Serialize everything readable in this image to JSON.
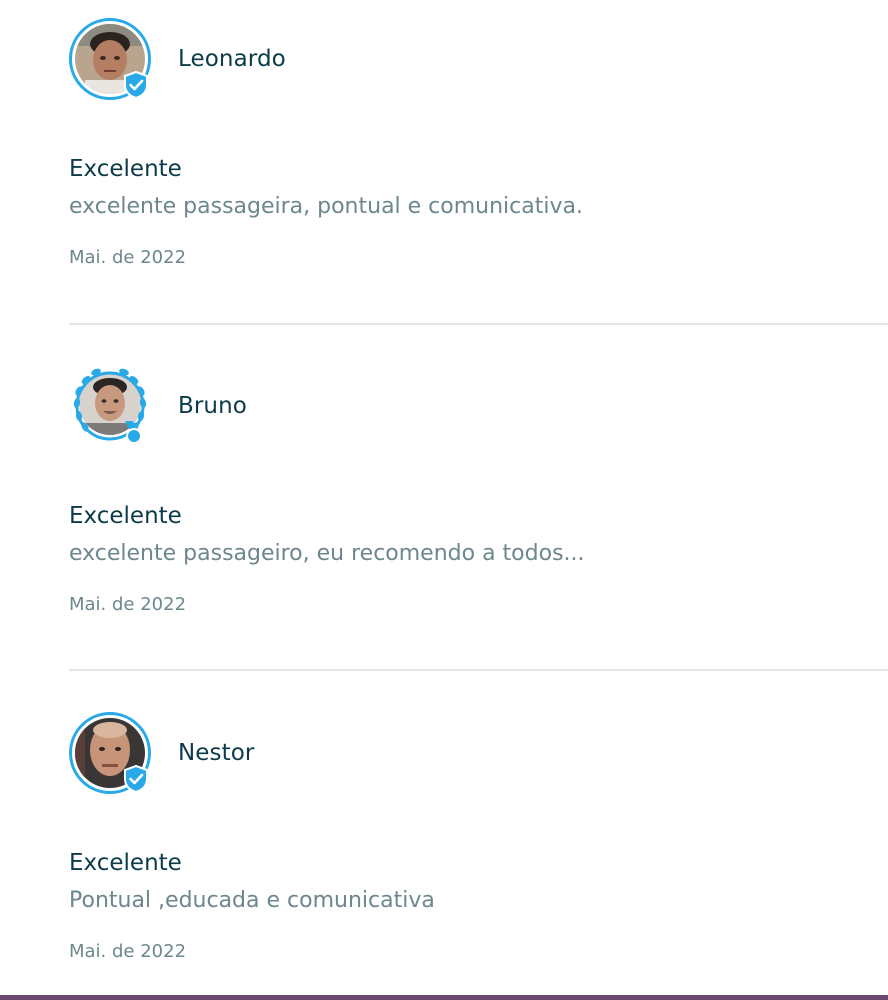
{
  "reviews": [
    {
      "name": "Leonardo",
      "rating": "Excelente",
      "comment": "excelente passageira, pontual e comunicativa.",
      "date": "Mai. de 2022",
      "badge": "verified-shield-icon"
    },
    {
      "name": "Bruno",
      "rating": "Excelente",
      "comment": "excelente passageiro, eu recomendo a todos...",
      "date": "Mai. de 2022",
      "badge": "medal-laurel-icon"
    },
    {
      "name": "Nestor",
      "rating": "Excelente",
      "comment": "Pontual ,educada e comunicativa",
      "date": "Mai. de 2022",
      "badge": "verified-shield-icon"
    }
  ],
  "colors": {
    "accent": "#2aa9e8",
    "title": "#0b3b49",
    "muted": "#6c878d",
    "divider": "#e3e7e8"
  }
}
